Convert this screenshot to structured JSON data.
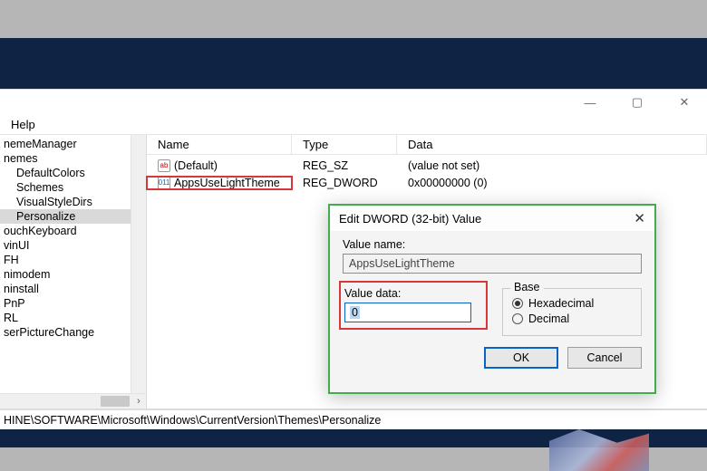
{
  "window": {
    "menu": {
      "help": "Help"
    },
    "titlebar": {
      "minimize": "—",
      "maximize": "▢",
      "close": "✕"
    }
  },
  "tree": {
    "items": [
      {
        "label": "nemeManager",
        "indent": 0
      },
      {
        "label": "nemes",
        "indent": 0
      },
      {
        "label": "DefaultColors",
        "indent": 1
      },
      {
        "label": "Schemes",
        "indent": 1
      },
      {
        "label": "VisualStyleDirs",
        "indent": 1
      },
      {
        "label": "Personalize",
        "indent": 1
      },
      {
        "label": "ouchKeyboard",
        "indent": 0
      },
      {
        "label": "vinUI",
        "indent": 0
      },
      {
        "label": "FH",
        "indent": 0
      },
      {
        "label": "nimodem",
        "indent": 0
      },
      {
        "label": "ninstall",
        "indent": 0
      },
      {
        "label": "PnP",
        "indent": 0
      },
      {
        "label": "RL",
        "indent": 0
      },
      {
        "label": "serPictureChange",
        "indent": 0
      }
    ],
    "selected_index": 5
  },
  "list": {
    "headers": {
      "name": "Name",
      "type": "Type",
      "data": "Data"
    },
    "rows": [
      {
        "icon": "sz",
        "name": "(Default)",
        "type": "REG_SZ",
        "data": "(value not set)"
      },
      {
        "icon": "dw",
        "name": "AppsUseLightTheme",
        "type": "REG_DWORD",
        "data": "0x00000000 (0)"
      }
    ],
    "highlight_row": 1
  },
  "status": {
    "path": "HINE\\SOFTWARE\\Microsoft\\Windows\\CurrentVersion\\Themes\\Personalize"
  },
  "dialog": {
    "title": "Edit DWORD (32-bit) Value",
    "close": "✕",
    "value_name_label": "Value name:",
    "value_name": "AppsUseLightTheme",
    "value_data_label": "Value data:",
    "value_data": "0",
    "base_label": "Base",
    "radios": {
      "hex": "Hexadecimal",
      "dec": "Decimal"
    },
    "selected_base": "hex",
    "buttons": {
      "ok": "OK",
      "cancel": "Cancel"
    }
  },
  "icons": {
    "sz": "ab",
    "dw": "011"
  }
}
